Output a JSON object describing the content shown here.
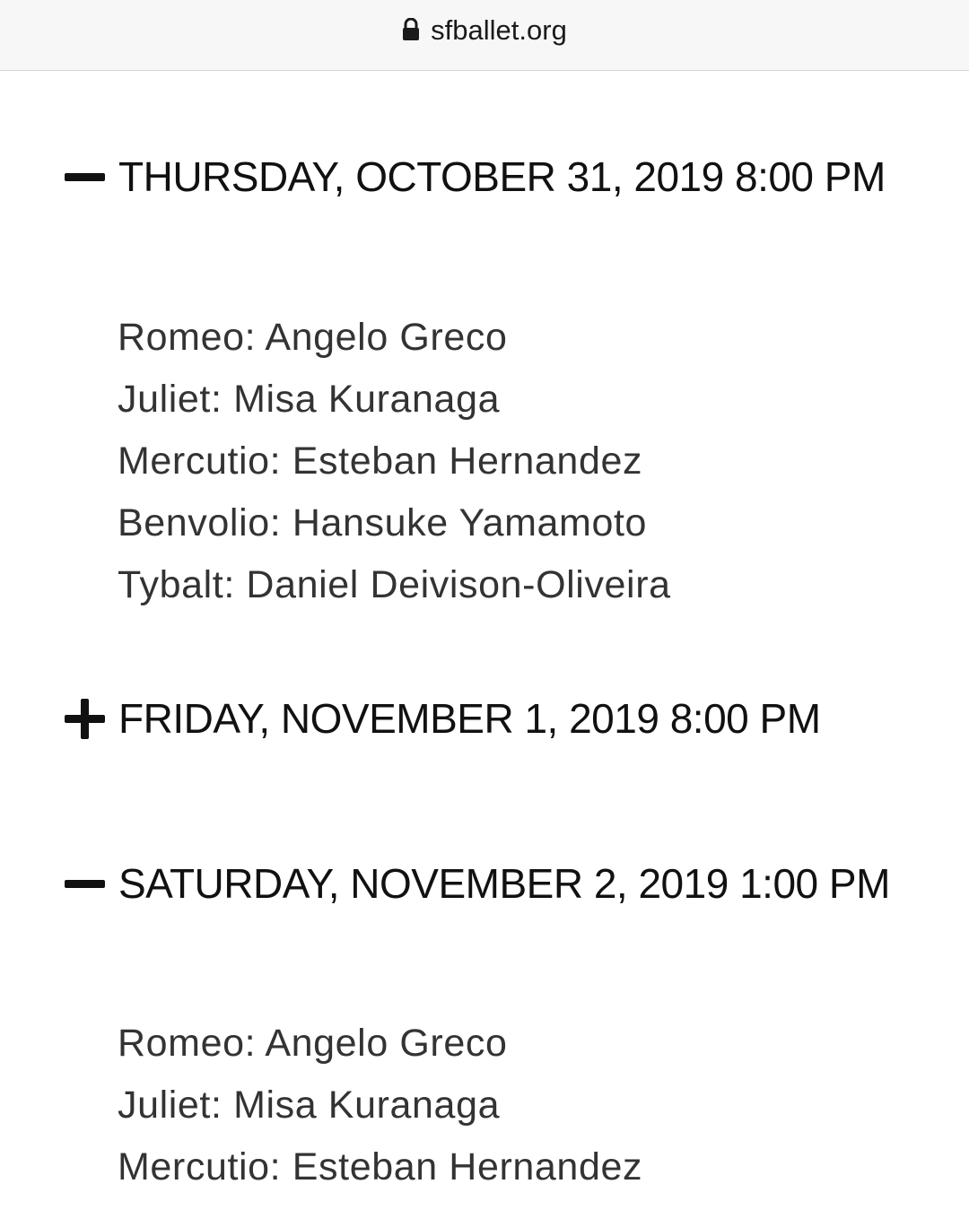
{
  "browser": {
    "url": "sfballet.org",
    "lock_icon": "lock-icon"
  },
  "performances": [
    {
      "expanded": true,
      "toggle_icon": "minus-icon",
      "datetime": "THURSDAY, OCTOBER 31, 2019 8:00 PM",
      "cast": [
        "Romeo: Angelo Greco",
        "Juliet: Misa Kuranaga",
        "Mercutio: Esteban Hernandez",
        "Benvolio: Hansuke Yamamoto",
        "Tybalt: Daniel Deivison-Oliveira"
      ]
    },
    {
      "expanded": false,
      "toggle_icon": "plus-icon",
      "datetime": "FRIDAY, NOVEMBER 1, 2019 8:00 PM",
      "cast": []
    },
    {
      "expanded": true,
      "toggle_icon": "minus-icon",
      "datetime": "SATURDAY, NOVEMBER 2, 2019 1:00 PM",
      "cast": [
        "Romeo: Angelo Greco",
        "Juliet: Misa Kuranaga",
        "Mercutio: Esteban Hernandez"
      ]
    }
  ]
}
